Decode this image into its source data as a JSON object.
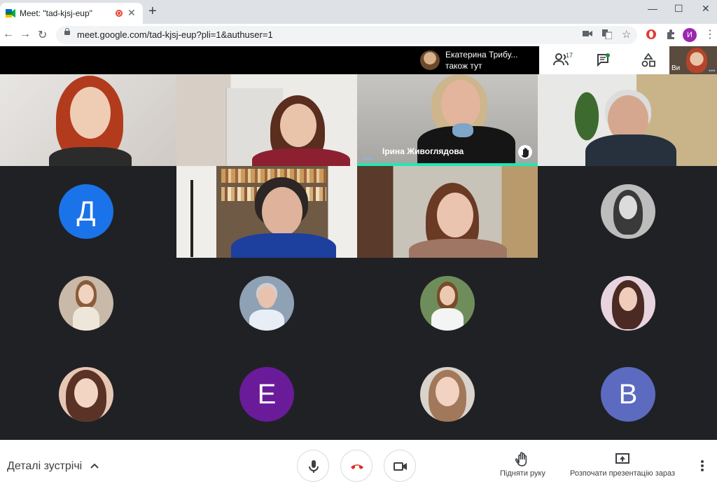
{
  "browser": {
    "tab_title": "Meet: \"tad-kjsj-eup\"",
    "url": "meet.google.com/tad-kjsj-eup?pli=1&authuser=1",
    "profile_initial": "И",
    "window_buttons": [
      "—",
      "☐",
      "✕"
    ]
  },
  "meet": {
    "presence_name": "Екатерина Трибу...",
    "presence_sub": "також тут",
    "participant_count": "17",
    "self_label": "Ви",
    "speaker_name": "Ірина Живоглядова",
    "avatar_letters": [
      "Д",
      "Е",
      "В"
    ],
    "colors": {
      "d_avatar": "#1a73e8",
      "e_avatar": "#6a1b9a",
      "v_avatar": "#5c6bc0",
      "hangup": "#d93025",
      "speaking": "#1de9b6"
    }
  },
  "bottom": {
    "details_label": "Деталі зустрічі",
    "raise_hand_label": "Підняти руку",
    "present_label": "Розпочати презентацію зараз"
  }
}
